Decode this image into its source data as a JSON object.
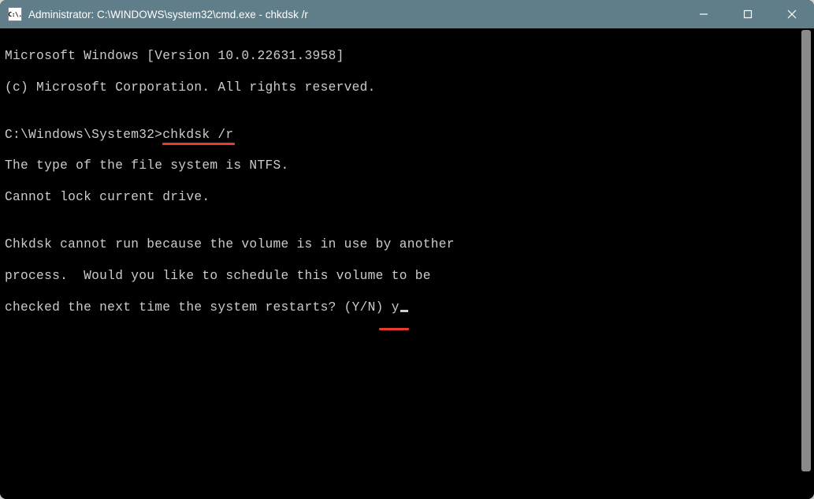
{
  "titlebar": {
    "icon_text": "C:\\.",
    "title": "Administrator: C:\\WINDOWS\\system32\\cmd.exe - chkdsk  /r"
  },
  "console": {
    "line1": "Microsoft Windows [Version 10.0.22631.3958]",
    "line2": "(c) Microsoft Corporation. All rights reserved.",
    "blank1": "",
    "prompt": "C:\\Windows\\System32>",
    "command": "chkdsk /r",
    "line4": "The type of the file system is NTFS.",
    "line5": "Cannot lock current drive.",
    "blank2": "",
    "line6": "Chkdsk cannot run because the volume is in use by another",
    "line7": "process.  Would you like to schedule this volume to be",
    "line8a": "checked the next time the system restarts? (Y/N) ",
    "answer": "y"
  }
}
